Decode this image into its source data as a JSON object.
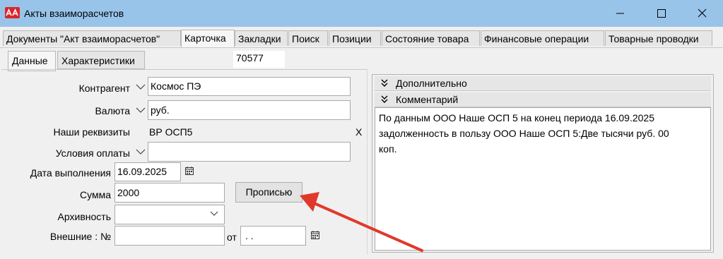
{
  "window": {
    "title": "Акты взаиморасчетов",
    "app_icon_text": "АА",
    "accent_color": "#99c4ea"
  },
  "tabs": [
    {
      "label": "Документы \"Акт взаиморасчетов\"",
      "active": false
    },
    {
      "label": "Карточка",
      "active": true
    },
    {
      "label": "Закладки",
      "active": false
    },
    {
      "label": "Поиск",
      "active": false
    },
    {
      "label": "Позиции",
      "active": false
    },
    {
      "label": "Состояние товара",
      "active": false
    },
    {
      "label": "Финансовые операции",
      "active": false
    },
    {
      "label": "Товарные проводки",
      "active": false
    }
  ],
  "subtabs": [
    {
      "label": "Данные",
      "active": true
    },
    {
      "label": "Характеристики",
      "active": false
    }
  ],
  "document_id": "70577",
  "form": {
    "counterparty": {
      "label": "Контрагент",
      "value": "Космос ПЭ"
    },
    "currency": {
      "label": "Валюта",
      "value": "руб."
    },
    "requisites": {
      "label": "Наши реквизиты",
      "value": "ВР ОСП5",
      "clear_glyph": "X"
    },
    "payment_terms": {
      "label": "Условия оплаты",
      "value": ""
    },
    "completion_date": {
      "label": "Дата выполнения",
      "value": "16.09.2025"
    },
    "amount": {
      "label": "Сумма",
      "value": "2000",
      "button_label": "Прописью"
    },
    "archive": {
      "label": "Архивность",
      "value": ""
    },
    "external": {
      "label": "Внешние : №",
      "value": "",
      "from_label": "от",
      "date_value": " .  ."
    }
  },
  "right_panel": {
    "additional_header": "Дополнительно",
    "comment_header": "Комментарий",
    "comment_lines": [
      "По данным ООО Наше ОСП 5 на конец периода 16.09.2025",
      "задолженность в пользу ООО Наше ОСП 5:Две тысячи руб. 00",
      "коп."
    ]
  },
  "annotation": {
    "arrow_color": "#e0392b"
  }
}
